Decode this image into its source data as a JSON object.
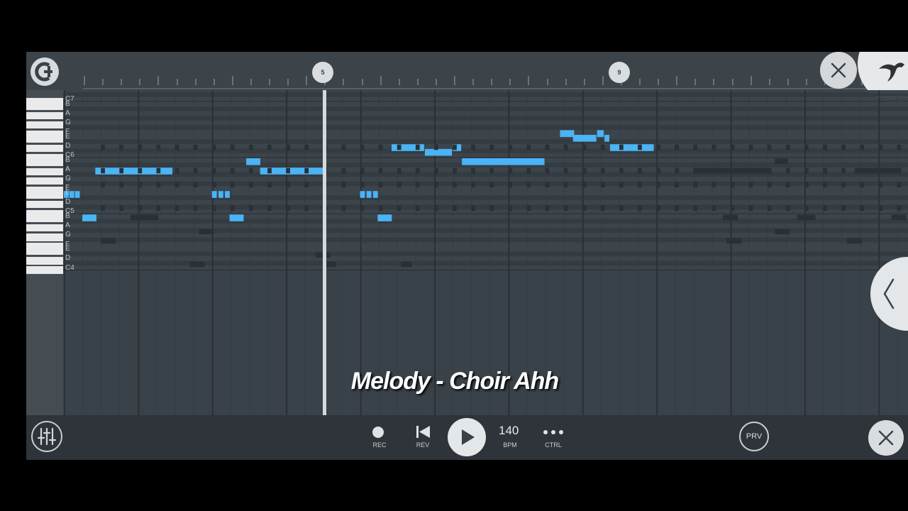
{
  "ruler": {
    "markers": [
      "5",
      "9"
    ]
  },
  "piano": {
    "labels": [
      "C7",
      "B",
      "A",
      "G",
      "F",
      "E",
      "D",
      "C6",
      "B",
      "A",
      "G",
      "F",
      "E",
      "D",
      "C5",
      "B",
      "A",
      "G",
      "F",
      "E",
      "D",
      "C4"
    ]
  },
  "caption": "Melody - Choir Ahh",
  "transport": {
    "rec_label": "REC",
    "rev_label": "REV",
    "bpm_value": "140",
    "bpm_label": "BPM",
    "ctrl_label": "CTRL",
    "prv_label": "PRV"
  },
  "colors": {
    "note": "#4ab4f5",
    "ghost_note": "#2a3035",
    "background": "#3a4249"
  },
  "icons": {
    "logo": "channel-logo-icon",
    "close": "close-icon",
    "fl_logo": "fruit-logo-icon",
    "collapse": "chevron-left-icon",
    "mixer": "mixer-sliders-icon",
    "record": "record-icon",
    "rewind": "skip-back-icon",
    "play": "play-icon",
    "more": "more-dots-icon"
  }
}
